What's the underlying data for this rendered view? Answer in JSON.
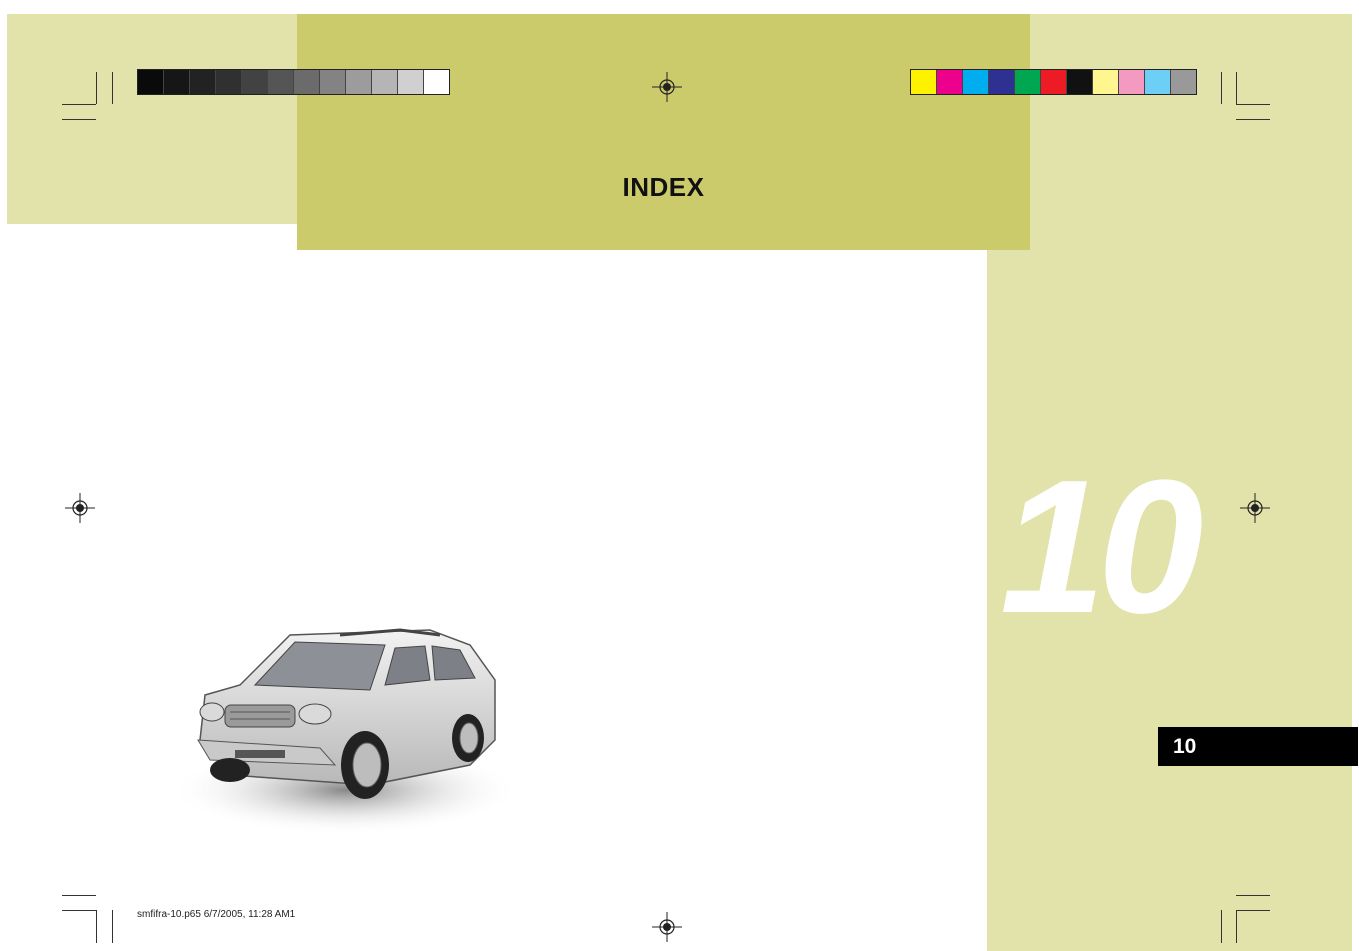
{
  "header": {
    "title": "INDEX"
  },
  "chapter": {
    "big_number": "10",
    "tab_label": "10"
  },
  "footer": {
    "slug": "smfifra-10.p65   6/7/2005, 11:28 AM1"
  },
  "print_marks": {
    "grayscale_swatches": [
      "#0a0a0a",
      "#161616",
      "#222222",
      "#303030",
      "#424242",
      "#555555",
      "#6b6b6b",
      "#838383",
      "#9c9c9c",
      "#b5b5b5",
      "#d0d0d0",
      "#ffffff"
    ],
    "color_swatches": [
      "#fff200",
      "#ec008c",
      "#00aeef",
      "#2e3192",
      "#00a651",
      "#ed1c24",
      "#111111",
      "#fff68f",
      "#f49ac1",
      "#6dcff6",
      "#999999"
    ]
  },
  "colors": {
    "band_light": "#e2e3ab",
    "band_dark": "#cbcb6b",
    "tab": "#000000"
  },
  "images": {
    "vehicle": "suv-illustration"
  }
}
